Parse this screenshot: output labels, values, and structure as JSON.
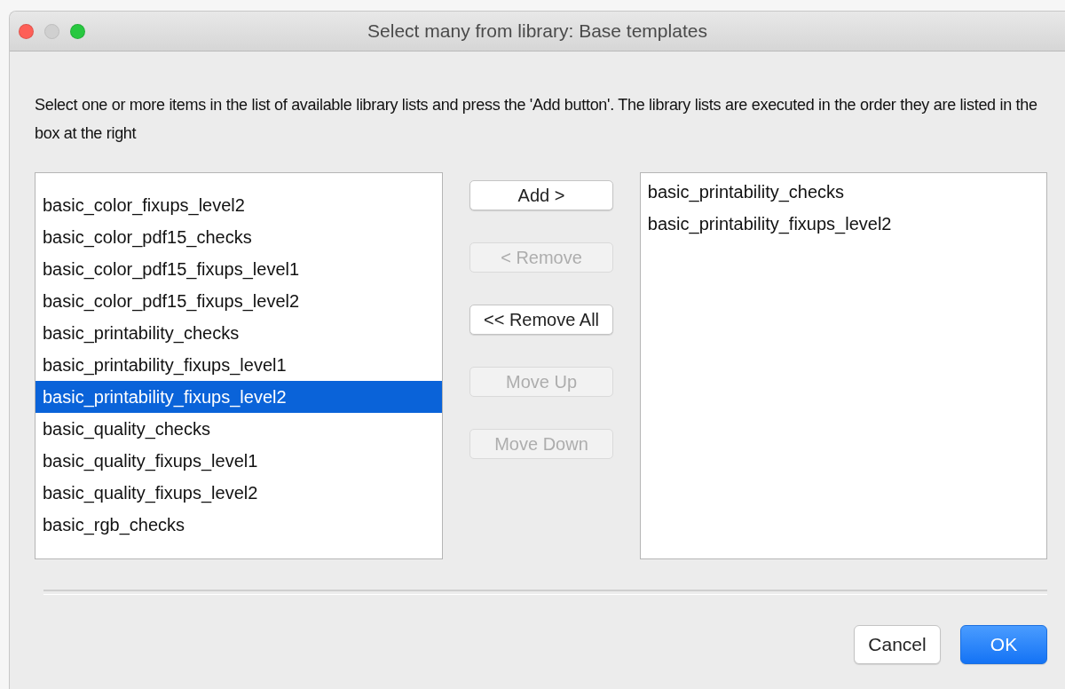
{
  "window": {
    "title": "Select many from library: Base templates",
    "controls": [
      {
        "kind": "close",
        "disabled": false
      },
      {
        "kind": "minimize",
        "disabled": true
      },
      {
        "kind": "zoom",
        "disabled": false
      }
    ]
  },
  "instructions": "Select one or more items in the list of available library lists and press the 'Add button'. The library lists are executed in the order they are listed in the box at the right",
  "available": [
    {
      "label": "basic_color_fixups_level2",
      "selected": false
    },
    {
      "label": "basic_color_pdf15_checks",
      "selected": false
    },
    {
      "label": "basic_color_pdf15_fixups_level1",
      "selected": false
    },
    {
      "label": "basic_color_pdf15_fixups_level2",
      "selected": false
    },
    {
      "label": "basic_printability_checks",
      "selected": false
    },
    {
      "label": "basic_printability_fixups_level1",
      "selected": false
    },
    {
      "label": "basic_printability_fixups_level2",
      "selected": true
    },
    {
      "label": "basic_quality_checks",
      "selected": false
    },
    {
      "label": "basic_quality_fixups_level1",
      "selected": false
    },
    {
      "label": "basic_quality_fixups_level2",
      "selected": false
    },
    {
      "label": "basic_rgb_checks",
      "selected": false
    }
  ],
  "actions": [
    {
      "label": "Add >",
      "disabled": false
    },
    {
      "label": "< Remove",
      "disabled": true
    },
    {
      "label": "<< Remove All",
      "disabled": false
    },
    {
      "label": "Move Up",
      "disabled": true
    },
    {
      "label": "Move Down",
      "disabled": true
    }
  ],
  "chosen": [
    {
      "label": "basic_printability_checks",
      "selected": false
    },
    {
      "label": "basic_printability_fixups_level2",
      "selected": false
    }
  ],
  "buttons": [
    {
      "label": "Cancel",
      "kind": "default"
    },
    {
      "label": "OK",
      "kind": "primary"
    }
  ]
}
